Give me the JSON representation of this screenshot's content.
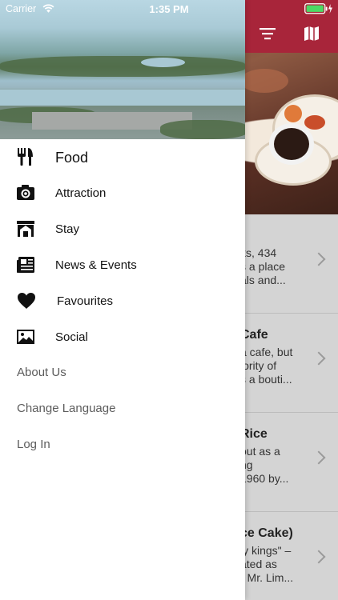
{
  "status_bar": {
    "carrier": "Carrier",
    "time": "1:35 PM"
  },
  "background_list": {
    "rows": [
      {
        "title": "",
        "lines": [
          "ks, 434",
          "s a place",
          "als and..."
        ]
      },
      {
        "title": "Cafe",
        "lines": [
          "a cafe, but",
          "jority of",
          "s a bouti..."
        ]
      },
      {
        "title": "Rice",
        "lines": [
          "out as a",
          "ng",
          "1960 by..."
        ]
      },
      {
        "title": "ce Cake)",
        "lines": [
          "ly kings\" –",
          "ated as",
          "r Mr. Lim..."
        ]
      }
    ]
  },
  "drawer": {
    "menu": [
      {
        "label": "Food",
        "icon": "fork-knife-icon"
      },
      {
        "label": "Attraction",
        "icon": "camera-icon"
      },
      {
        "label": "Stay",
        "icon": "hotel-icon"
      },
      {
        "label": "News & Events",
        "icon": "newspaper-icon"
      },
      {
        "label": "Favourites",
        "icon": "heart-icon"
      },
      {
        "label": "Social",
        "icon": "image-icon"
      }
    ],
    "secondary": [
      {
        "label": "About Us"
      },
      {
        "label": "Change Language"
      },
      {
        "label": "Log In"
      }
    ]
  },
  "colors": {
    "nav_bar": "#a8253a",
    "battery": "#4cd964"
  }
}
